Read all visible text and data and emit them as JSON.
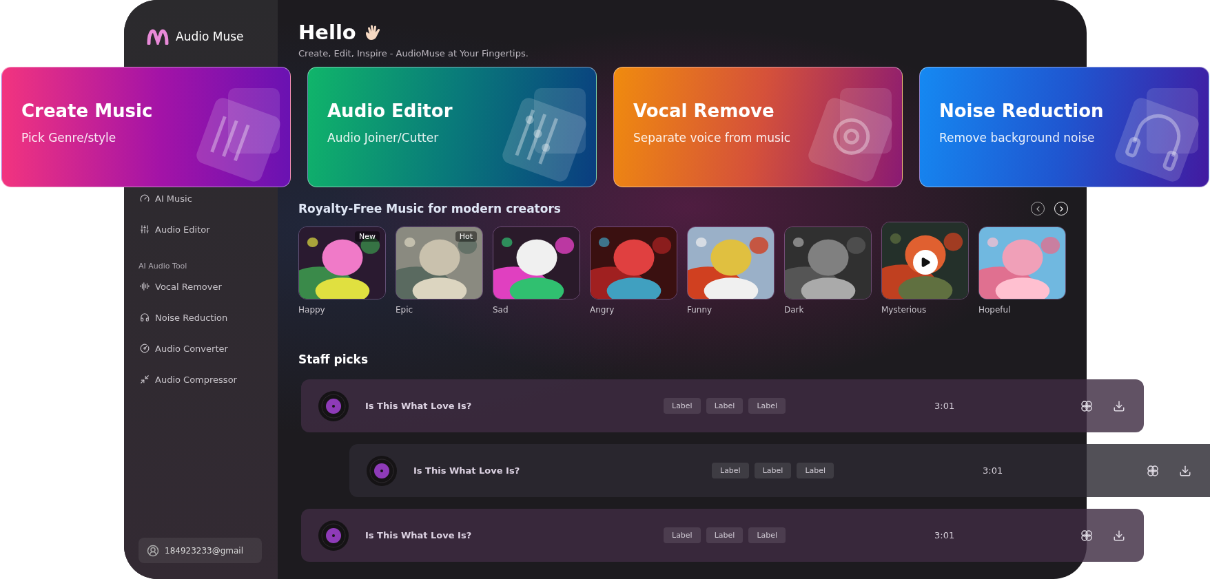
{
  "sidebar": {
    "logo": "Audio Muse",
    "nav": [
      {
        "kind": "item",
        "label": "AI Music"
      },
      {
        "kind": "item",
        "label": "Audio Editor"
      },
      {
        "kind": "heading",
        "label": "AI Audio Tool"
      },
      {
        "kind": "item",
        "label": "Vocal Remover"
      },
      {
        "kind": "item",
        "label": "Noise Reduction"
      },
      {
        "kind": "item",
        "label": "Audio Converter"
      },
      {
        "kind": "item",
        "label": "Audio Compressor"
      }
    ],
    "account": {
      "email": "184923233@gmail"
    }
  },
  "header": {
    "title": "Hello",
    "subtitle": "Create, Edit, Inspire - AudioMuse at Your Fingertips."
  },
  "cards": [
    {
      "title": "Create Music",
      "subtitle": "Pick Genre/style"
    },
    {
      "title": "Audio Editor",
      "subtitle": "Audio Joiner/Cutter"
    },
    {
      "title": "Vocal Remove",
      "subtitle": "Separate voice from music"
    },
    {
      "title": "Noise Reduction",
      "subtitle": "Remove background noise"
    }
  ],
  "music": {
    "title": "Royalty-Free Music for modern creators",
    "items": [
      {
        "label": "Happy",
        "badge": "New",
        "hovered": false
      },
      {
        "label": "Epic",
        "badge": "Hot",
        "hovered": false
      },
      {
        "label": "Sad",
        "hovered": false
      },
      {
        "label": "Angry",
        "hovered": false
      },
      {
        "label": "Funny",
        "hovered": false
      },
      {
        "label": "Dark",
        "hovered": false
      },
      {
        "label": "Mysterious",
        "hovered": true
      },
      {
        "label": "Hopeful",
        "hovered": false
      }
    ]
  },
  "staff_picks": {
    "title": "Staff picks",
    "rows": [
      {
        "title": "Is This What Love Is?",
        "tags": [
          "Label",
          "Label",
          "Label"
        ],
        "duration": "3:01",
        "indented": false
      },
      {
        "title": "Is This What Love Is?",
        "tags": [
          "Label",
          "Label",
          "Label"
        ],
        "duration": "3:01",
        "indented": true
      },
      {
        "title": "Is This What Love Is?",
        "tags": [
          "Label",
          "Label",
          "Label"
        ],
        "duration": "3:01",
        "indented": false
      }
    ]
  }
}
